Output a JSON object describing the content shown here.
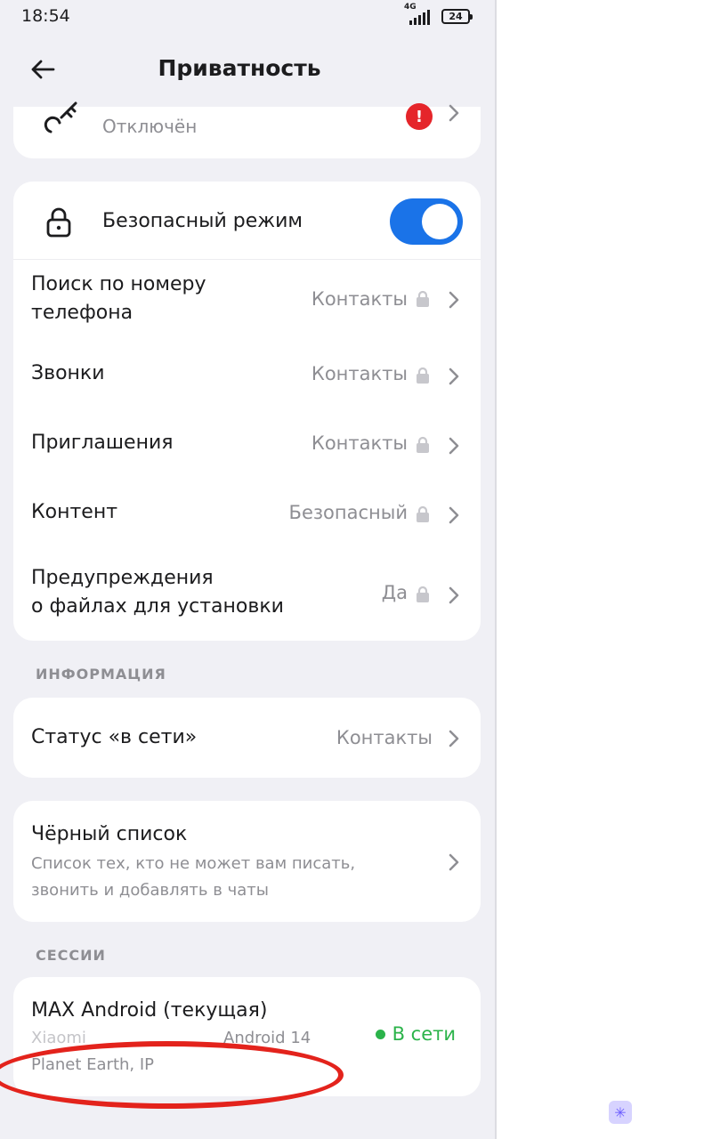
{
  "status_bar": {
    "time": "18:54",
    "network": "4G",
    "battery": "24"
  },
  "header": {
    "title": "Приватность"
  },
  "top_card": {
    "status": "Отключён"
  },
  "security_card": {
    "safe_mode_label": "Безопасный режим",
    "safe_mode_on": true,
    "rows": [
      {
        "label_line1": "Поиск по номеру",
        "label_line2": "телефона",
        "value": "Контакты"
      },
      {
        "label": "Звонки",
        "value": "Контакты"
      },
      {
        "label": "Приглашения",
        "value": "Контакты"
      },
      {
        "label": "Контент",
        "value": "Безопасный"
      },
      {
        "label_line1": "Предупреждения",
        "label_line2": "о файлах для установки",
        "value": "Да"
      }
    ]
  },
  "info_section": {
    "title": "ИНФОРМАЦИЯ",
    "online_status": {
      "label": "Статус «в сети»",
      "value": "Контакты"
    },
    "blacklist": {
      "label": "Чёрный список",
      "desc_line1": "Список тех, кто не может вам писать,",
      "desc_line2": "звонить и добавлять в чаты"
    }
  },
  "sessions_section": {
    "title": "СЕССИИ",
    "session": {
      "name": "MAX Android (текущая)",
      "device": "Xiaomi",
      "os": "Android 14",
      "location": "Planet Earth, IP",
      "status": "В сети"
    }
  },
  "colors": {
    "accent": "#1a73e8",
    "online": "#2bb34a",
    "alert": "#e5252a",
    "annotation": "#e3231c"
  }
}
